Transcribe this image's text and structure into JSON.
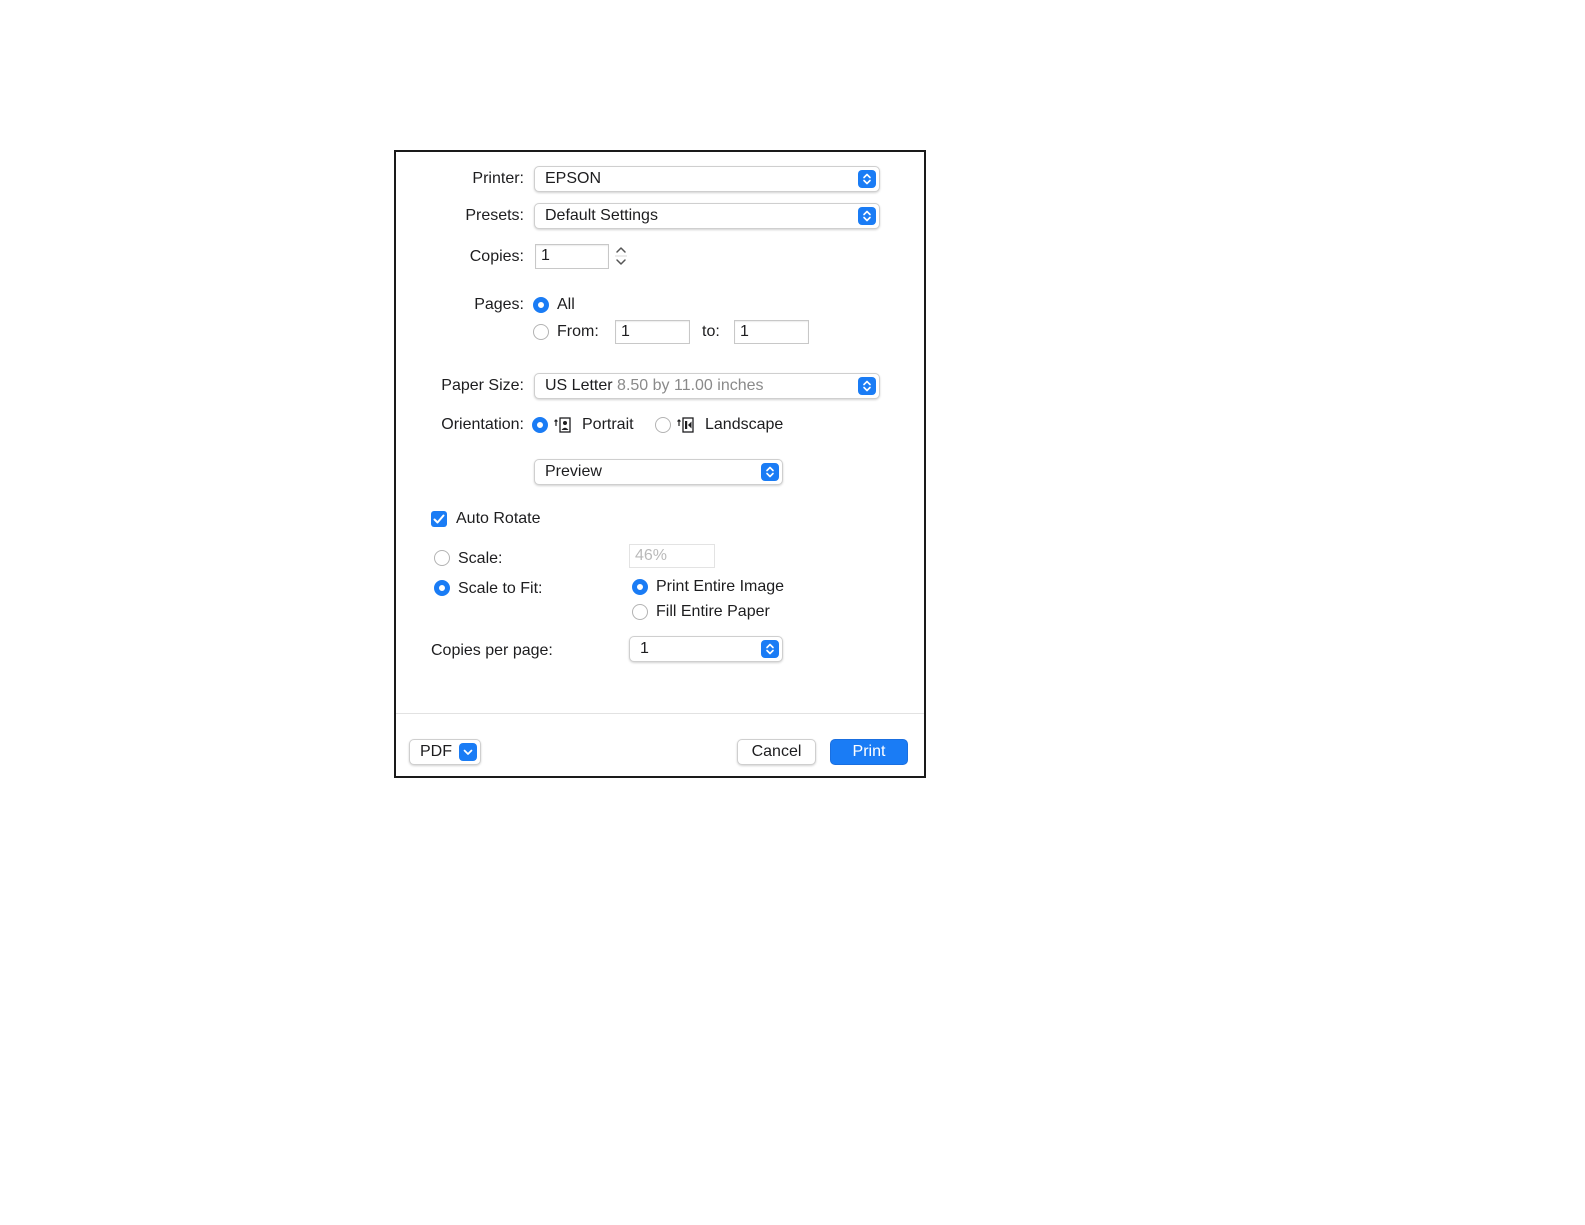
{
  "printer": {
    "label": "Printer:",
    "value": "EPSON"
  },
  "presets": {
    "label": "Presets:",
    "value": "Default Settings"
  },
  "copies": {
    "label": "Copies:",
    "value": "1"
  },
  "pages": {
    "label": "Pages:",
    "all_label": "All",
    "from_label": "From:",
    "from_value": "1",
    "to_label": "to:",
    "to_value": "1",
    "selected": "all"
  },
  "paper_size": {
    "label": "Paper Size:",
    "value": "US Letter",
    "detail": "8.50 by 11.00 inches"
  },
  "orientation": {
    "label": "Orientation:",
    "portrait_label": "Portrait",
    "landscape_label": "Landscape",
    "selected": "portrait"
  },
  "section_popup": {
    "value": "Preview"
  },
  "auto_rotate": {
    "label": "Auto Rotate",
    "checked": true
  },
  "scale": {
    "label": "Scale:",
    "value": "46%"
  },
  "scale_to_fit": {
    "label": "Scale to Fit:",
    "print_entire_label": "Print Entire Image",
    "fill_entire_label": "Fill Entire Paper",
    "selected": "print_entire_image"
  },
  "copies_per_page": {
    "label": "Copies per page:",
    "value": "1"
  },
  "footer": {
    "pdf_label": "PDF",
    "cancel_label": "Cancel",
    "print_label": "Print"
  },
  "colors": {
    "accent": "#1a7cf5",
    "border": "#1a1a1a"
  }
}
